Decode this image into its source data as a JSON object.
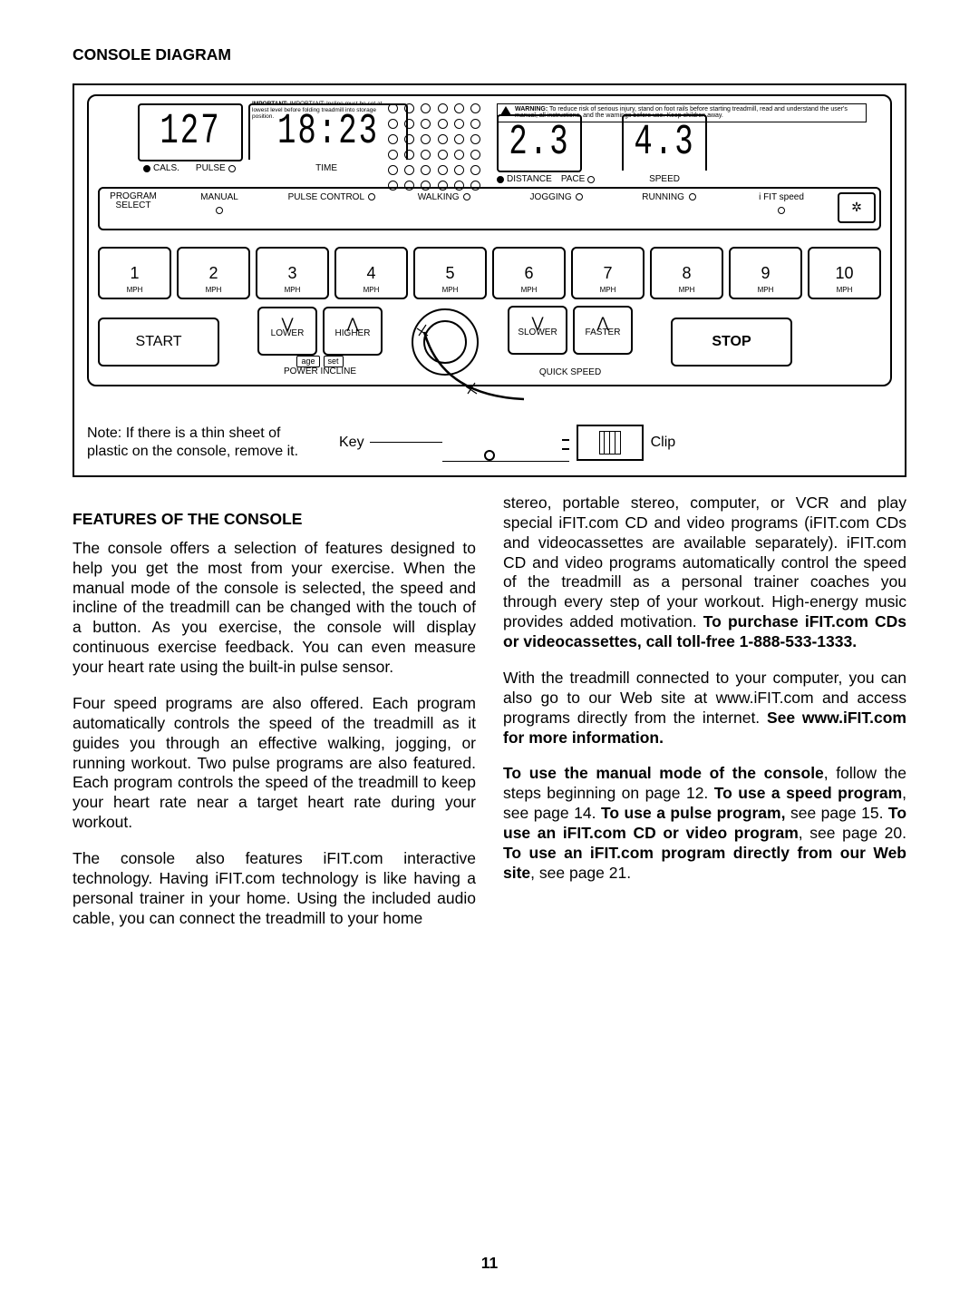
{
  "page_number": "11",
  "heading_console_diagram": "CONSOLE DIAGRAM",
  "heading_features": "FEATURES OF THE CONSOLE",
  "diagram": {
    "important_text": "IMPORTANT: Incline must be set at lowest level before folding treadmill into storage position.",
    "warning_label": "WARNING:",
    "warning_text": "To reduce risk of serious injury, stand on foot rails before starting treadmill, read and understand the user's manual, all instructions, and the warnings before use. Keep children away.",
    "lcd": {
      "cals": "127",
      "time": "18:23",
      "distance": "2.3",
      "speed": "4.3"
    },
    "labels": {
      "cals": "CALS.",
      "pulse": "PULSE",
      "time": "TIME",
      "distance": "DISTANCE",
      "pace": "PACE",
      "speed": "SPEED",
      "program": "PROGRAM",
      "select": "SELECT",
      "manual": "MANUAL",
      "pulse_control": "PULSE CONTROL",
      "walking": "WALKING",
      "jogging": "JOGGING",
      "running": "RUNNING",
      "ifit_speed": "i FIT speed",
      "mph": "MPH",
      "start": "START",
      "stop": "STOP",
      "lower": "LOWER",
      "higher": "HIGHER",
      "slower": "SLOWER",
      "faster": "FASTER",
      "age": "age",
      "set": "set",
      "power_incline": "POWER INCLINE",
      "quick_speed": "QUICK SPEED",
      "note": "Note: If there is a thin sheet of plastic on the console, remove it.",
      "key": "Key",
      "clip": "Clip"
    },
    "speeds": [
      "1",
      "2",
      "3",
      "4",
      "5",
      "6",
      "7",
      "8",
      "9",
      "10"
    ]
  },
  "text": {
    "p1": "The console offers a selection of features designed to help you get the most from your exercise. When the manual mode of the console is selected, the speed and incline of the treadmill can be changed with the touch of a button. As you exercise, the console will display continuous exercise feedback. You can even measure your heart rate using the built-in pulse sensor.",
    "p2": "Four speed programs are also offered. Each program automatically controls the speed of the treadmill as it guides you through an effective walking, jogging, or running workout. Two pulse programs are also featured. Each program controls the speed of the treadmill to keep your heart rate near a target heart rate during your workout.",
    "p3": "The console also features iFIT.com interactive technology. Having iFIT.com technology is like having a personal trainer in your home. Using the included audio cable, you can connect the treadmill to your home",
    "p4a": "stereo, portable stereo, computer, or VCR and play special iFIT.com CD and video programs (iFIT.com CDs and videocassettes are available separately). iFIT.com CD and video programs automatically control the speed of the treadmill as a personal trainer coaches you through every step of your workout. High-energy music provides added motivation. ",
    "p4b": "To purchase iFIT.com CDs or videocassettes, call toll-free 1-888-533-1333.",
    "p5a": "With the treadmill connected to your computer, you can also go to our Web site at www.iFIT.com and access programs directly from the internet. ",
    "p5b": "See www.iFIT.com for more information.",
    "p6_1a": "To use the manual mode of the console",
    "p6_1b": ", follow the steps beginning on page 12. ",
    "p6_2a": "To use a speed program",
    "p6_2b": ", see page 14. ",
    "p6_3a": "To use a pulse program,",
    "p6_3b": " see page 15. ",
    "p6_4a": "To use an iFIT.com CD or video program",
    "p6_4b": ", see page 20. ",
    "p6_5a": "To use an iFIT.com program directly from our Web site",
    "p6_5b": ", see page 21."
  }
}
